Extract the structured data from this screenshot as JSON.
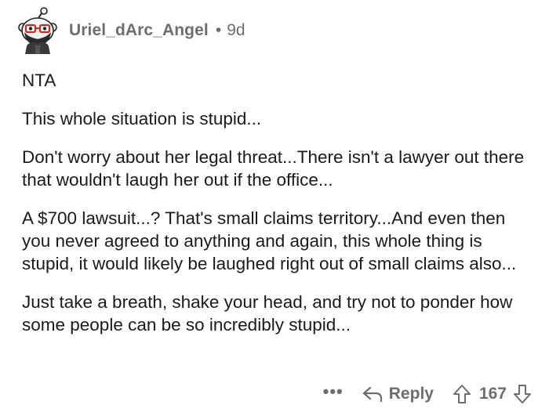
{
  "comment": {
    "username": "Uriel_dArc_Angel",
    "separator": "•",
    "age": "9d",
    "paragraphs": [
      "NTA",
      "This whole situation is stupid...",
      "Don't worry about her legal threat...There isn't a lawyer out there that wouldn't laugh her out if the office...",
      "A $700 lawsuit...?  That's small claims territory...And even then you never agreed to anything and again, this whole thing is stupid, it would likely be laughed right out of small claims also...",
      "Just take a breath, shake your head, and try not to ponder how some people can be so incredibly stupid..."
    ]
  },
  "actions": {
    "more_label": "•••",
    "reply_label": "Reply",
    "score": "167"
  },
  "icons": {
    "avatar": "snoo-avatar-icon",
    "reply": "reply-arrow-icon",
    "upvote": "upvote-arrow-icon",
    "downvote": "downvote-arrow-icon"
  },
  "colors": {
    "text": "#1a1a1b",
    "meta": "#6b6e71",
    "avatar_accent": "#ff4500"
  }
}
